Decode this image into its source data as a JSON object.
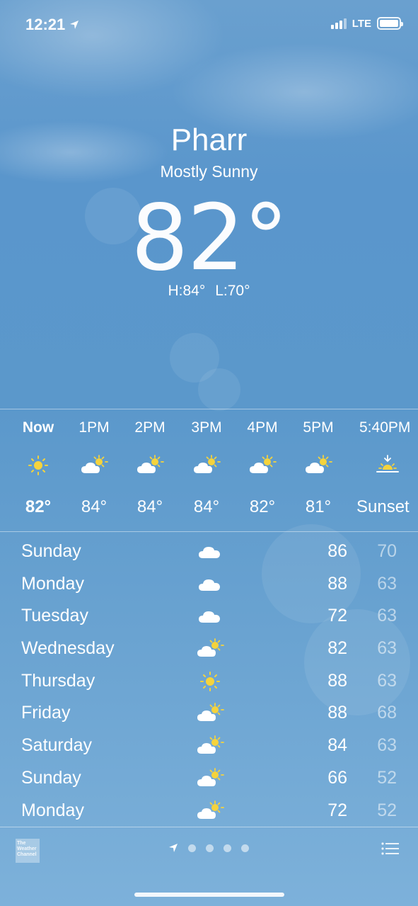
{
  "status_bar": {
    "time": "12:21",
    "network": "LTE"
  },
  "location": {
    "city": "Pharr",
    "condition": "Mostly Sunny",
    "temperature": "82°",
    "high": "H:84°",
    "low": "L:70°"
  },
  "hourly": [
    {
      "time": "Now",
      "icon": "sun-icon",
      "temp": "82°"
    },
    {
      "time": "1PM",
      "icon": "partly-cloudy-icon",
      "temp": "84°"
    },
    {
      "time": "2PM",
      "icon": "partly-cloudy-icon",
      "temp": "84°"
    },
    {
      "time": "3PM",
      "icon": "partly-cloudy-icon",
      "temp": "84°"
    },
    {
      "time": "4PM",
      "icon": "partly-cloudy-icon",
      "temp": "82°"
    },
    {
      "time": "5PM",
      "icon": "partly-cloudy-icon",
      "temp": "81°"
    },
    {
      "time": "5:40PM",
      "icon": "sunset-icon",
      "temp": "Sunset"
    }
  ],
  "daily": [
    {
      "day": "Sunday",
      "icon": "cloud-icon",
      "high": "86",
      "low": "70"
    },
    {
      "day": "Monday",
      "icon": "cloud-icon",
      "high": "88",
      "low": "63"
    },
    {
      "day": "Tuesday",
      "icon": "cloud-icon",
      "high": "72",
      "low": "63"
    },
    {
      "day": "Wednesday",
      "icon": "partly-cloudy-icon",
      "high": "82",
      "low": "63"
    },
    {
      "day": "Thursday",
      "icon": "sun-icon",
      "high": "88",
      "low": "63"
    },
    {
      "day": "Friday",
      "icon": "partly-cloudy-icon",
      "high": "88",
      "low": "68"
    },
    {
      "day": "Saturday",
      "icon": "partly-cloudy-icon",
      "high": "84",
      "low": "63"
    },
    {
      "day": "Sunday",
      "icon": "partly-cloudy-icon",
      "high": "66",
      "low": "52"
    },
    {
      "day": "Monday",
      "icon": "partly-cloudy-icon",
      "high": "72",
      "low": "52"
    }
  ],
  "footer": {
    "logo_text": "The Weather Channel",
    "page_count": 4,
    "current_page": "location"
  },
  "colors": {
    "sun": "#f5d33c",
    "cloud": "#ffffff",
    "sky": "#5b98cb"
  }
}
